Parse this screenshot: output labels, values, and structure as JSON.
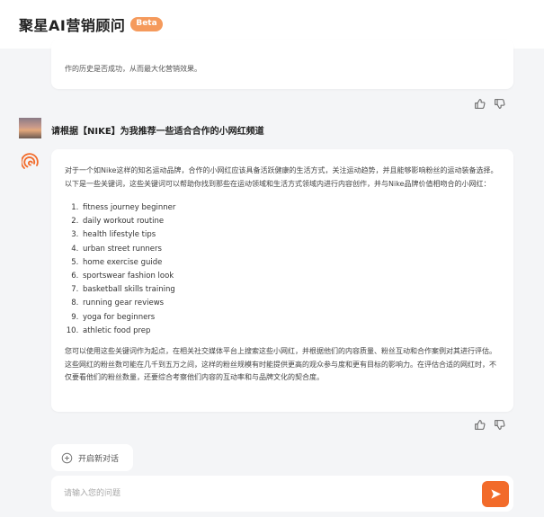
{
  "header": {
    "title": "聚星AI营销顾问",
    "badge": "Beta"
  },
  "previous_answer": {
    "tail_text": "作的历史是否成功，从而最大化营销效果。"
  },
  "question": {
    "text": "请根据【NIKE】为我推荐一些适合合作的小网红频道"
  },
  "answer": {
    "intro": "对于一个如Nike这样的知名运动品牌，合作的小网红应该具备活跃健康的生活方式，关注运动趋势，并且能够影响粉丝的运动装备选择。以下是一些关键词，这些关键词可以帮助你找到那些在运动领域和生活方式领域内进行内容创作，并与Nike品牌价值相吻合的小网红：",
    "keywords": [
      "fitness journey beginner",
      "daily workout routine",
      "health lifestyle tips",
      "urban street runners",
      "home exercise guide",
      "sportswear fashion look",
      "basketball skills training",
      "running gear reviews",
      "yoga for beginners",
      "athletic food prep"
    ],
    "outro": "您可以使用这些关键词作为起点，在相关社交媒体平台上搜索这些小网红，并根据他们的内容质量、粉丝互动和合作案例对其进行评估。这些网红的粉丝数可能在几千到五万之间，这样的粉丝规模有时能提供更高的观众参与度和更有目标的影响力。在评估合适的网红时，不仅要看他们的粉丝数量，还要综合考察他们内容的互动率和与品牌文化的契合度。"
  },
  "actions": {
    "new_chat_label": "开启新对话"
  },
  "input": {
    "placeholder": "请输入您的问题",
    "value": ""
  },
  "colors": {
    "accent": "#f26b2a",
    "badge": "#f59a5c",
    "background": "#f4f5f7"
  },
  "icons": {
    "like": "thumbs-up-icon",
    "dislike": "thumbs-down-icon",
    "bot": "bot-logo-icon",
    "new_chat": "plus-circle-icon",
    "send": "send-icon"
  }
}
